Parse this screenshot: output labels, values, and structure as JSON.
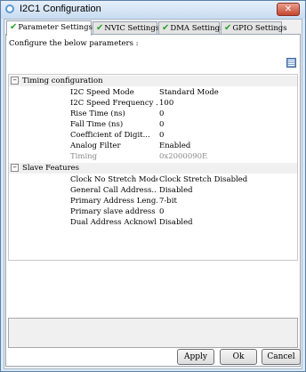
{
  "window": {
    "title": "I2C1 Configuration",
    "close_glyph": "✕"
  },
  "tabs": [
    {
      "label": "Parameter Settings",
      "check_icon": "✔"
    },
    {
      "label": "NVIC Settings",
      "check_icon": "✔"
    },
    {
      "label": "DMA Settings",
      "check_icon": "✔"
    },
    {
      "label": "GPIO Settings",
      "check_icon": "✔"
    }
  ],
  "description": "Configure the below parameters :",
  "categories": [
    {
      "name": "Timing configuration",
      "toggle": "−",
      "rows": [
        {
          "label": "I2C Speed Mode",
          "value": "Standard Mode"
        },
        {
          "label": "I2C Speed Frequency ...",
          "value": "100"
        },
        {
          "label": "Rise Time (ns)",
          "value": "0"
        },
        {
          "label": "Fall Time (ns)",
          "value": "0"
        },
        {
          "label": "Coefficient of Digit...",
          "value": "0"
        },
        {
          "label": "Analog Filter",
          "value": "Enabled"
        },
        {
          "label": "Timing",
          "value": "0x2000090E"
        }
      ]
    },
    {
      "name": "Slave Features",
      "toggle": "−",
      "rows": [
        {
          "label": "Clock No Stretch Mode",
          "value": "Clock Stretch Disabled"
        },
        {
          "label": "General Call Address...",
          "value": "Disabled"
        },
        {
          "label": "Primary Address Leng...",
          "value": "7-bit"
        },
        {
          "label": "Primary slave address",
          "value": "0"
        },
        {
          "label": "Dual Address Acknowl...",
          "value": "Disabled"
        }
      ]
    }
  ],
  "buttons": {
    "apply": "Apply",
    "ok": "Ok",
    "cancel": "Cancel"
  }
}
